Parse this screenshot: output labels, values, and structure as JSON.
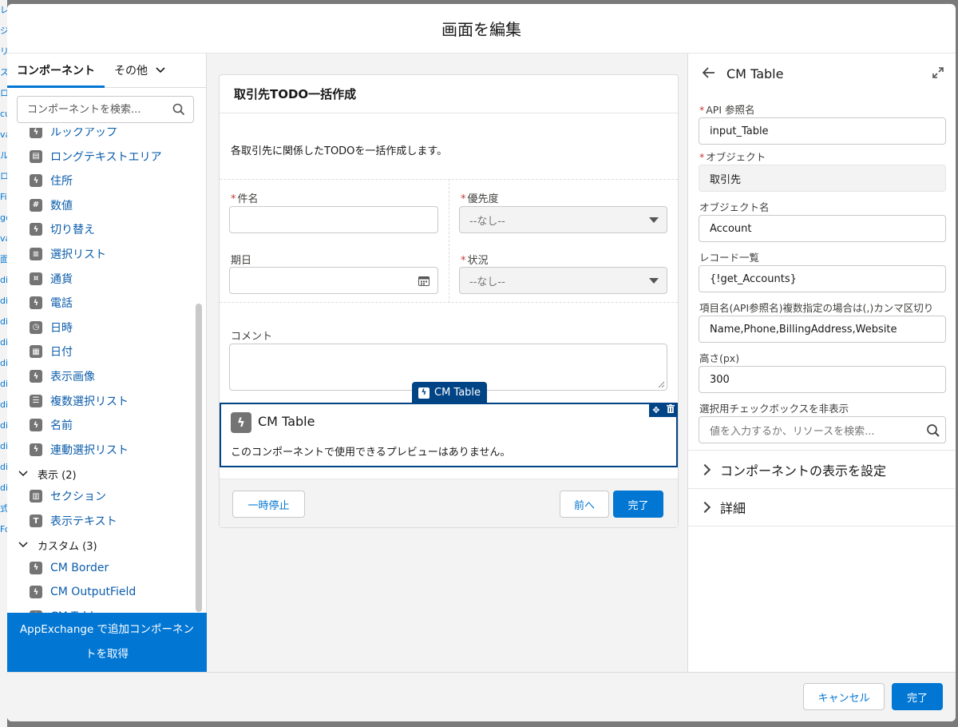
{
  "modal": {
    "title": "画面を編集"
  },
  "background_strip": [
    "レ",
    "ジ",
    "リ",
    "ス",
    "ロ",
    "cu",
    "va",
    "ル",
    "ロ",
    "Fil",
    "ge",
    "va",
    "面",
    "di",
    "di",
    "di",
    "di",
    "di",
    "di",
    "di",
    "di",
    "di",
    "di",
    "di",
    "式",
    "Fo"
  ],
  "left_panel": {
    "tabs": [
      {
        "label": "コンポーネント",
        "active": true
      },
      {
        "label": "その他",
        "active": false
      }
    ],
    "search_placeholder": "コンポーネントを検索...",
    "items": [
      {
        "type": "item",
        "label": "ルックアップ",
        "icon": "lightning-icon"
      },
      {
        "type": "item",
        "label": "ロングテキストエリア",
        "icon": "textarea-icon"
      },
      {
        "type": "item",
        "label": "住所",
        "icon": "lightning-icon"
      },
      {
        "type": "item",
        "label": "数値",
        "icon": "number-icon"
      },
      {
        "type": "item",
        "label": "切り替え",
        "icon": "lightning-icon"
      },
      {
        "type": "item",
        "label": "選択リスト",
        "icon": "list-icon"
      },
      {
        "type": "item",
        "label": "通貨",
        "icon": "currency-icon"
      },
      {
        "type": "item",
        "label": "電話",
        "icon": "lightning-icon"
      },
      {
        "type": "item",
        "label": "日時",
        "icon": "datetime-icon"
      },
      {
        "type": "item",
        "label": "日付",
        "icon": "date-icon"
      },
      {
        "type": "item",
        "label": "表示画像",
        "icon": "lightning-icon"
      },
      {
        "type": "item",
        "label": "複数選択リスト",
        "icon": "multiselect-icon"
      },
      {
        "type": "item",
        "label": "名前",
        "icon": "lightning-icon"
      },
      {
        "type": "item",
        "label": "連動選択リスト",
        "icon": "lightning-icon"
      },
      {
        "type": "group",
        "label": "表示 (2)"
      },
      {
        "type": "item",
        "label": "セクション",
        "icon": "section-icon"
      },
      {
        "type": "item",
        "label": "表示テキスト",
        "icon": "text-icon"
      },
      {
        "type": "group",
        "label": "カスタム (3)"
      },
      {
        "type": "item",
        "label": "CM Border",
        "icon": "lightning-icon"
      },
      {
        "type": "item",
        "label": "CM OutputField",
        "icon": "lightning-icon"
      },
      {
        "type": "item",
        "label": "CM Table",
        "icon": "lightning-icon"
      }
    ],
    "appexchange_button": "AppExchange で追加コンポーネントを取得"
  },
  "canvas": {
    "title": "取引先TODO一括作成",
    "description": "各取引先に関係したTODOを一括作成します。",
    "fields": {
      "subject_label": "件名",
      "priority_label": "優先度",
      "priority_value": "--なし--",
      "date_label": "期日",
      "status_label": "状況",
      "status_value": "--なし--",
      "comment_label": "コメント"
    },
    "selected_component": {
      "tag": "CM Table",
      "title": "CM Table",
      "preview_text": "このコンポーネントで使用できるプレビューはありません。"
    },
    "footer": {
      "pause": "一時停止",
      "previous": "前へ",
      "finish": "完了"
    }
  },
  "right_panel": {
    "title": "CM Table",
    "fields": {
      "api_name_label": "API 参照名",
      "api_name_value": "input_Table",
      "object_label": "オブジェクト",
      "object_value": "取引先",
      "object_name_label": "オブジェクト名",
      "object_name_value": "Account",
      "records_label": "レコード一覧",
      "records_value": "{!get_Accounts}",
      "columns_label": "項目名(API参照名)複数指定の場合は(,)カンマ区切り",
      "columns_value": "Name,Phone,BillingAddress,Website",
      "height_label": "高さ(px)",
      "height_value": "300",
      "hide_checkbox_label": "選択用チェックボックスを非表示",
      "hide_checkbox_placeholder": "値を入力するか、リソースを検索..."
    },
    "sections": {
      "visibility": "コンポーネントの表示を設定",
      "details": "詳細"
    }
  },
  "modal_footer": {
    "cancel": "キャンセル",
    "done": "完了"
  },
  "colors": {
    "brand": "#0176d3",
    "selected": "#014486",
    "link": "#0b5cab",
    "required": "#c23934"
  }
}
